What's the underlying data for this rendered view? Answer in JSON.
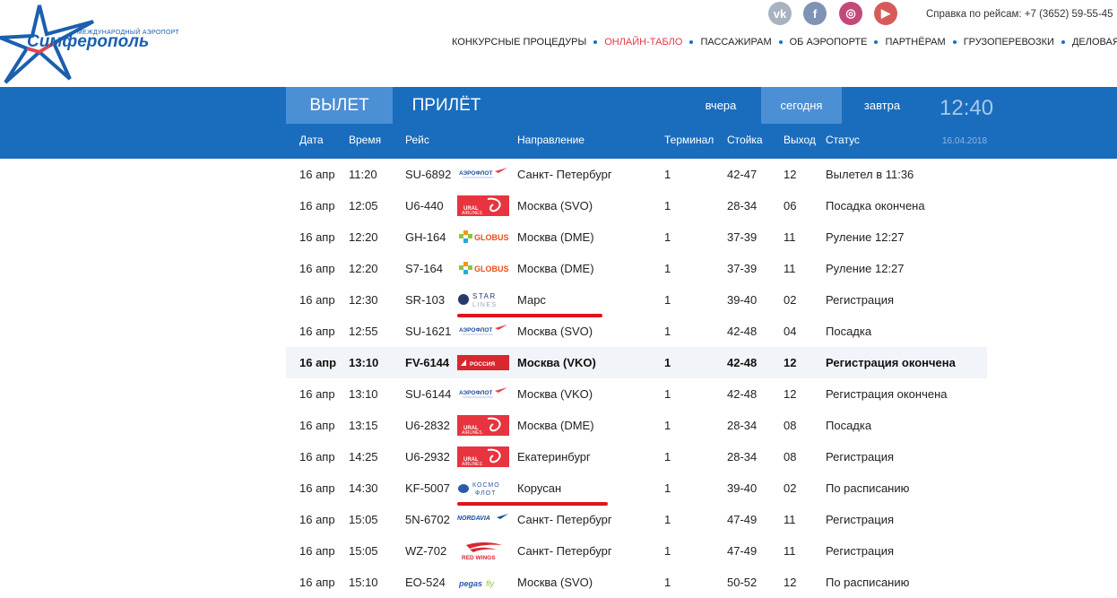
{
  "logo": {
    "subtitle": "Международный аэропорт",
    "title": "Симферополь"
  },
  "social": [
    {
      "name": "vk-icon",
      "text": "vk",
      "color": "#a8b3bf"
    },
    {
      "name": "facebook-icon",
      "text": "f",
      "color": "#7f93b4"
    },
    {
      "name": "instagram-icon",
      "text": "◎",
      "color": "#c2497a"
    },
    {
      "name": "youtube-icon",
      "text": "▶",
      "color": "#d75a5a"
    }
  ],
  "help": "Справка по рейсам: +7 (3652) 59-55-45",
  "topnav": [
    "КОНКУРСНЫЕ ПРОЦЕДУРЫ",
    "ОНЛАЙН-ТАБЛО",
    "ПАССАЖИРАМ",
    "ОБ АЭРОПОРТЕ",
    "ПАРТНЁРАМ",
    "ГРУЗОПЕРЕВОЗКИ",
    "ДЕЛОВАЯ АВИАЦИЯ"
  ],
  "topnav_active": "ОНЛАЙН-ТАБЛО",
  "board": {
    "tab_depart": "ВЫЛЕТ",
    "tab_arrive": "ПРИЛЁТ",
    "day_yesterday": "вчера",
    "day_today": "сегодня",
    "day_tomorrow": "завтра",
    "clock": "12:40",
    "date": "16.04.2018",
    "columns": [
      "Дата",
      "Время",
      "Рейс",
      "Направление",
      "Терминал",
      "Стойка",
      "Выход",
      "Статус"
    ]
  },
  "colors": {
    "board_blue": "#1a6dbd",
    "tab_active": "#4b8fd4",
    "nav_active": "#e23a4a",
    "annotation_red": "#e0141c"
  },
  "flights": [
    {
      "date": "16 апр",
      "time": "11:20",
      "flight": "SU-6892",
      "airline": "АЭРОФЛОТ",
      "airline_icon": "aeroflot-logo",
      "dir": "Санкт- Петербург",
      "term": "1",
      "desk": "42-47",
      "gate": "12",
      "status": "Вылетел в 11:36"
    },
    {
      "date": "16 апр",
      "time": "12:05",
      "flight": "U6-440",
      "airline": "URAL AIRLINES",
      "airline_icon": "ural-logo",
      "dir": "Москва (SVO)",
      "term": "1",
      "desk": "28-34",
      "gate": "06",
      "status": "Посадка окончена"
    },
    {
      "date": "16 апр",
      "time": "12:20",
      "flight": "GH-164",
      "airline": "GLOBUS",
      "airline_icon": "globus-logo",
      "dir": "Москва (DME)",
      "term": "1",
      "desk": "37-39",
      "gate": "11",
      "status": "Руление 12:27"
    },
    {
      "date": "16 апр",
      "time": "12:20",
      "flight": "S7-164",
      "airline": "GLOBUS",
      "airline_icon": "globus-logo",
      "dir": "Москва (DME)",
      "term": "1",
      "desk": "37-39",
      "gate": "11",
      "status": "Руление 12:27"
    },
    {
      "date": "16 апр",
      "time": "12:30",
      "flight": "SR-103",
      "airline": "STAR LINES",
      "airline_icon": "starlines-logo",
      "dir": "Марс",
      "term": "1",
      "desk": "39-40",
      "gate": "02",
      "status": "Регистрация"
    },
    {
      "date": "16 апр",
      "time": "12:55",
      "flight": "SU-1621",
      "airline": "АЭРОФЛОТ",
      "airline_icon": "aeroflot-logo",
      "dir": "Москва (SVO)",
      "term": "1",
      "desk": "42-48",
      "gate": "04",
      "status": "Посадка"
    },
    {
      "date": "16 апр",
      "time": "13:10",
      "flight": "FV-6144",
      "airline": "РОССИЯ",
      "airline_icon": "rossiya-logo",
      "dir": "Москва (VKO)",
      "term": "1",
      "desk": "42-48",
      "gate": "12",
      "status": "Регистрация окончена"
    },
    {
      "date": "16 апр",
      "time": "13:10",
      "flight": "SU-6144",
      "airline": "АЭРОФЛОТ",
      "airline_icon": "aeroflot-logo",
      "dir": "Москва (VKO)",
      "term": "1",
      "desk": "42-48",
      "gate": "12",
      "status": "Регистрация окончена"
    },
    {
      "date": "16 апр",
      "time": "13:15",
      "flight": "U6-2832",
      "airline": "URAL AIRLINES",
      "airline_icon": "ural-logo",
      "dir": "Москва (DME)",
      "term": "1",
      "desk": "28-34",
      "gate": "08",
      "status": "Посадка"
    },
    {
      "date": "16 апр",
      "time": "14:25",
      "flight": "U6-2932",
      "airline": "URAL AIRLINES",
      "airline_icon": "ural-logo",
      "dir": "Екатеринбург",
      "term": "1",
      "desk": "28-34",
      "gate": "08",
      "status": "Регистрация"
    },
    {
      "date": "16 апр",
      "time": "14:30",
      "flight": "KF-5007",
      "airline": "КОСМО ФЛОТ",
      "airline_icon": "kosmoflot-logo",
      "dir": "Корусан",
      "term": "1",
      "desk": "39-40",
      "gate": "02",
      "status": "По расписанию"
    },
    {
      "date": "16 апр",
      "time": "15:05",
      "flight": "5N-6702",
      "airline": "NORDAVIA",
      "airline_icon": "nordavia-logo",
      "dir": "Санкт- Петербург",
      "term": "1",
      "desk": "47-49",
      "gate": "11",
      "status": "Регистрация"
    },
    {
      "date": "16 апр",
      "time": "15:05",
      "flight": "WZ-702",
      "airline": "RED WINGS",
      "airline_icon": "redwings-logo",
      "dir": "Санкт- Петербург",
      "term": "1",
      "desk": "47-49",
      "gate": "11",
      "status": "Регистрация"
    },
    {
      "date": "16 апр",
      "time": "15:10",
      "flight": "EO-524",
      "airline": "pegas fly",
      "airline_icon": "pegas-logo",
      "dir": "Москва (SVO)",
      "term": "1",
      "desk": "50-52",
      "gate": "12",
      "status": "По расписанию"
    }
  ],
  "highlighted_row": 6,
  "annotations": [
    4,
    10
  ]
}
